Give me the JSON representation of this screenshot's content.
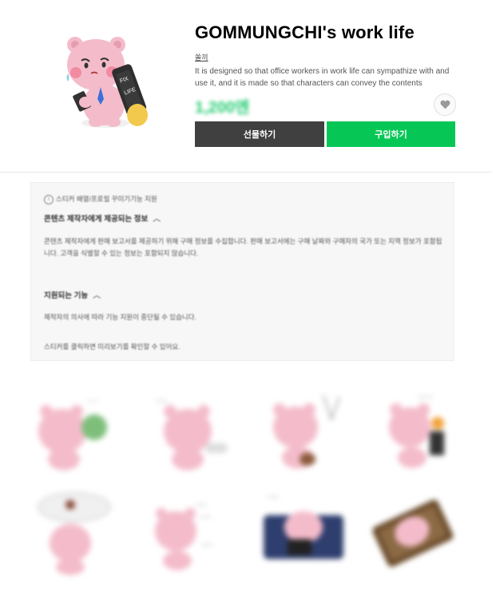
{
  "product": {
    "title": "GOMMUNGCHI's work life",
    "author": "쏠끼",
    "description": "It is designed so that office workers in work life can sympathize with and use it, and it is made so that characters can convey the contents",
    "price": "1,200엔",
    "gift_label": "선물하기",
    "buy_label": "구입하기",
    "main_sticker_text": [
      "FIX",
      "LIFE"
    ]
  },
  "info": {
    "support_line": "스티커 배열/프로필 꾸미기기능 지원",
    "section1_title": "콘텐츠 제작자에게 제공되는 정보",
    "section1_body": "콘텐츠 제작자에게 판매 보고서를 제공하기 위해 구매 정보를 수집합니다. 판매 보고서에는 구매 날짜와 구매자의 국가 또는 지역 정보가 포함됩니다. 고객을 식별할 수 있는 정보는 포함되지 않습니다.",
    "section2_title": "지원되는 기능",
    "section2_body": "제작자의 의사에 따라 기능 지원이 중단될 수 있습니다.",
    "preview_note": "스티커를 클릭하면 미리보기를 확인할 수 있어요."
  },
  "colors": {
    "buy": "#06c755",
    "gift": "#404040",
    "price": "#00c35c",
    "bear_pink": "#f2b8c8"
  },
  "icons": {
    "favorite": "heart-icon",
    "info": "info-circle-icon",
    "collapse": "chevron-up-icon"
  }
}
